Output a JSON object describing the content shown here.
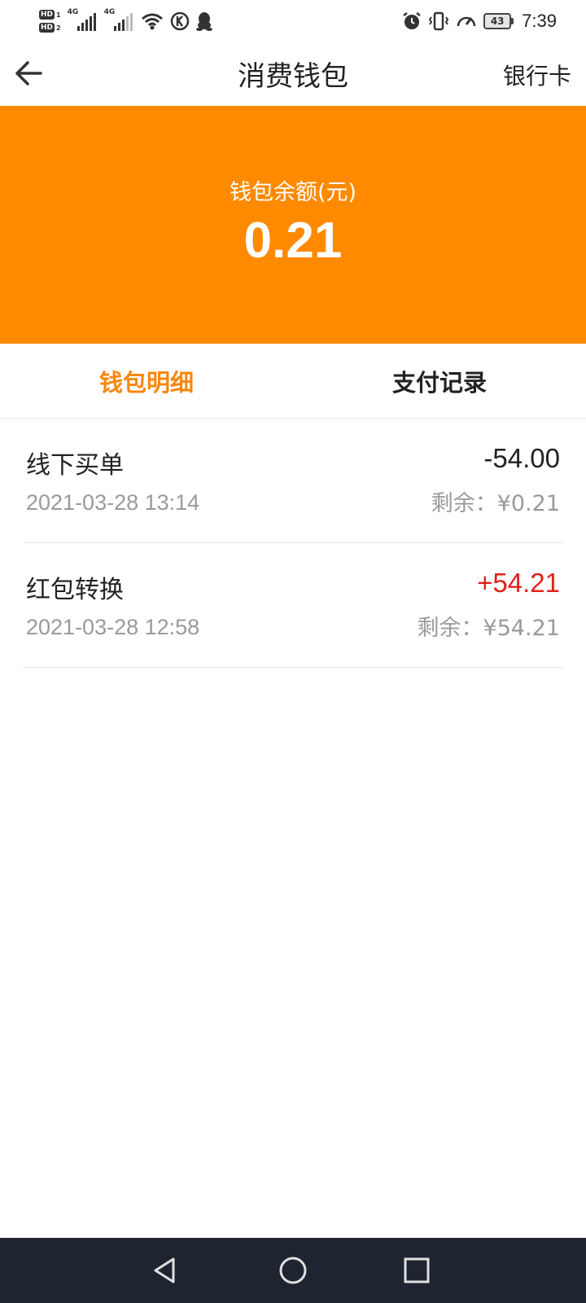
{
  "status_bar": {
    "hd_labels": [
      "HD",
      "HD"
    ],
    "hd_nums": [
      "1",
      "2"
    ],
    "net_labels": [
      "4G",
      "4G"
    ],
    "battery": "43",
    "time": "7:39"
  },
  "nav": {
    "title": "消费钱包",
    "right_action": "银行卡",
    "back_icon": "arrow-left-icon"
  },
  "balance": {
    "label": "钱包余额(元)",
    "value": "0.21",
    "bg_color": "#ff8a00"
  },
  "tabs": [
    {
      "label": "钱包明细",
      "active": true
    },
    {
      "label": "支付记录",
      "active": false
    }
  ],
  "transactions": [
    {
      "title": "线下买单",
      "date": "2021-03-28 13:14",
      "amount": "-54.00",
      "remaining": "剩余：¥0.21"
    },
    {
      "title": "红包转换",
      "date": "2021-03-28 12:58",
      "amount": "+54.21",
      "remaining": "剩余：¥54.21"
    }
  ],
  "colors": {
    "accent": "#f7870a",
    "positive": "#e3211b"
  }
}
